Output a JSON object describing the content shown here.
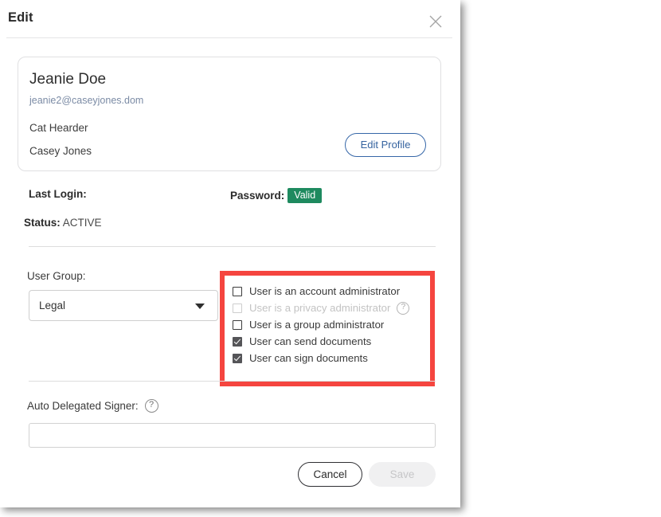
{
  "modal": {
    "title": "Edit",
    "close_icon": "close-icon"
  },
  "profile": {
    "name": "Jeanie Doe",
    "email": "jeanie2@caseyjones.dom",
    "role": "Cat Hearder",
    "company": "Casey Jones",
    "edit_profile_label": "Edit Profile"
  },
  "status": {
    "last_login_label": "Last Login:",
    "last_login_value": "",
    "password_label": "Password:",
    "password_badge": "Valid",
    "password_badge_color": "#1e8a5f",
    "status_label": "Status:",
    "status_value": "ACTIVE"
  },
  "user_group": {
    "label": "User Group:",
    "selected": "Legal",
    "chevron_icon": "chevron-down-icon"
  },
  "permissions": {
    "highlight_color": "#f5453f",
    "items": [
      {
        "label": "User is an account administrator",
        "checked": false,
        "disabled": false,
        "help": false
      },
      {
        "label": "User is a privacy administrator",
        "checked": false,
        "disabled": true,
        "help": true
      },
      {
        "label": "User is a group administrator",
        "checked": false,
        "disabled": false,
        "help": false
      },
      {
        "label": "User can send documents",
        "checked": true,
        "disabled": false,
        "help": false
      },
      {
        "label": "User can sign documents",
        "checked": true,
        "disabled": false,
        "help": false
      }
    ]
  },
  "auto_delegated_signer": {
    "label": "Auto Delegated Signer:",
    "help_icon": "help-icon",
    "value": "",
    "placeholder": ""
  },
  "footer": {
    "cancel_label": "Cancel",
    "save_label": "Save",
    "save_disabled": true
  }
}
